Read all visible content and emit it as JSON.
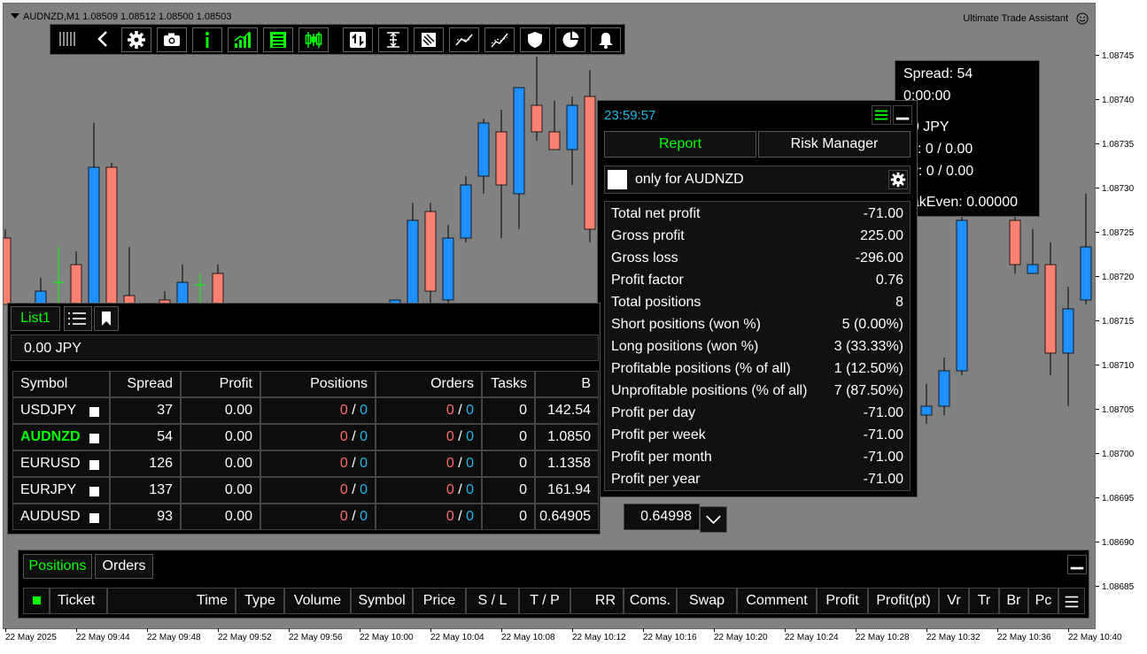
{
  "chart": {
    "symbol_info": "AUDNZD,M1  1.08509 1.08512 1.08500 1.08503",
    "assistant_label": "Ultimate Trade Assistant",
    "price_ticks": [
      "1.08745",
      "1.08740",
      "1.08735",
      "1.08730",
      "1.08725",
      "1.08720",
      "1.08715",
      "1.08710",
      "1.08705",
      "1.08700",
      "1.08695",
      "1.08690",
      "1.08685"
    ],
    "time_ticks": [
      "22 May 2025",
      "22 May 09:44",
      "22 May 09:48",
      "22 May 09:52",
      "22 May 09:56",
      "22 May 10:00",
      "22 May 10:04",
      "22 May 10:08",
      "22 May 10:12",
      "22 May 10:16",
      "22 May 10:20",
      "22 May 10:24",
      "22 May 10:28",
      "22 May 10:32",
      "22 May 10:36",
      "22 May 10:40"
    ],
    "colors": {
      "background": "#818181",
      "bull": "#1e90ff",
      "bear": "#fa8072",
      "doji": "#00ff00"
    }
  },
  "toolbar": {
    "icons": [
      "grip-icon",
      "back-icon",
      "gear-icon",
      "camera-icon",
      "info-icon",
      "signal-icon",
      "list-icon",
      "candles-icon",
      "updown-icon",
      "range-icon",
      "notes-icon",
      "trend-icon",
      "chart-line-icon",
      "shield-icon",
      "pie-icon",
      "bell-icon"
    ]
  },
  "spread_box": {
    "lines": [
      "Spread: 54",
      "0:00:00",
      "00 JPY",
      "ell: 0 / 0.00",
      "uy: 0 / 0.00",
      "eakEven: 0.00000"
    ]
  },
  "report": {
    "time": "23:59:57",
    "tab_report": "Report",
    "tab_risk": "Risk Manager",
    "filter_label": "only for AUDNZD",
    "stats": [
      {
        "k": "Total net profit",
        "v": "-71.00"
      },
      {
        "k": "Gross profit",
        "v": "225.00"
      },
      {
        "k": "Gross loss",
        "v": "-296.00"
      },
      {
        "k": "Profit factor",
        "v": "0.76"
      },
      {
        "k": "Total positions",
        "v": "8"
      },
      {
        "k": "Short positions (won %)",
        "v": "5 (0.00%)"
      },
      {
        "k": "Long positions (won %)",
        "v": "3 (33.33%)"
      },
      {
        "k": "Profitable positions (% of all)",
        "v": "1 (12.50%)"
      },
      {
        "k": "Unprofitable positions (% of all)",
        "v": "7 (87.50%)"
      },
      {
        "k": "Profit per day",
        "v": "-71.00"
      },
      {
        "k": "Profit per week",
        "v": "-71.00"
      },
      {
        "k": "Profit per month",
        "v": "-71.00"
      },
      {
        "k": "Profit per year",
        "v": "-71.00"
      }
    ]
  },
  "list": {
    "tab": "List1",
    "balance": "0.00 JPY",
    "headers": [
      "Symbol",
      "Spread",
      "Profit",
      "Positions",
      "Orders",
      "Tasks",
      "B"
    ],
    "rows": [
      {
        "symbol": "USDJPY",
        "spread": "37",
        "profit": "0.00",
        "pos_a": "0",
        "pos_b": "0",
        "ord_a": "0",
        "ord_b": "0",
        "tasks": "0",
        "bid": "142.54",
        "ask": ""
      },
      {
        "symbol": "AUDNZD",
        "spread": "54",
        "profit": "0.00",
        "pos_a": "0",
        "pos_b": "0",
        "ord_a": "0",
        "ord_b": "0",
        "tasks": "0",
        "bid": "1.0850",
        "ask": "",
        "active": true
      },
      {
        "symbol": "EURUSD",
        "spread": "126",
        "profit": "0.00",
        "pos_a": "0",
        "pos_b": "0",
        "ord_a": "0",
        "ord_b": "0",
        "tasks": "0",
        "bid": "1.1358",
        "ask": ""
      },
      {
        "symbol": "EURJPY",
        "spread": "137",
        "profit": "0.00",
        "pos_a": "0",
        "pos_b": "0",
        "ord_a": "0",
        "ord_b": "0",
        "tasks": "0",
        "bid": "161.94",
        "ask": ""
      },
      {
        "symbol": "AUDUSD",
        "spread": "93",
        "profit": "0.00",
        "pos_a": "0",
        "pos_b": "0",
        "ord_a": "0",
        "ord_b": "0",
        "tasks": "0",
        "bid": "0.64905",
        "ask": "0.64998"
      }
    ],
    "sep": " / "
  },
  "positions": {
    "tab_positions": "Positions",
    "tab_orders": "Orders",
    "headers": [
      "Ticket",
      "Time",
      "Type",
      "Volume",
      "Symbol",
      "Price",
      "S / L",
      "T / P",
      "RR",
      "Coms.",
      "Swap",
      "Comment",
      "Profit",
      "Profit(pt)",
      "Vr",
      "Tr",
      "Br",
      "Pc"
    ]
  }
}
